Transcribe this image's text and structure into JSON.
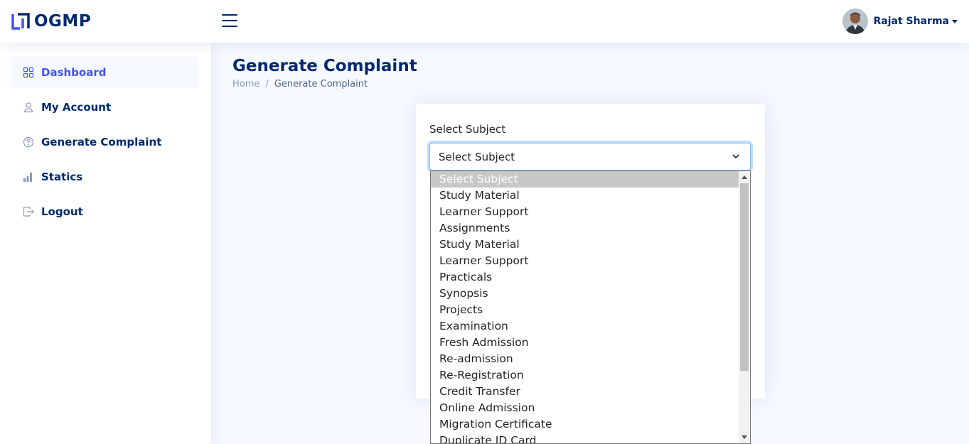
{
  "brand": {
    "name": "OGMP",
    "color": "#012970",
    "accent": "#4154f1"
  },
  "header": {
    "user_name": "Rajat Sharma"
  },
  "sidebar": {
    "items": [
      {
        "label": "Dashboard",
        "icon": "grid-icon",
        "active": true
      },
      {
        "label": "My Account",
        "icon": "person-icon"
      },
      {
        "label": "Generate Complaint",
        "icon": "question-circle-icon"
      },
      {
        "label": "Statics",
        "icon": "bar-chart-icon"
      },
      {
        "label": "Logout",
        "icon": "box-arrow-right-icon"
      }
    ]
  },
  "page": {
    "title": "Generate Complaint",
    "breadcrumb": [
      "Home",
      "Generate Complaint"
    ]
  },
  "form": {
    "subject_label": "Select Subject",
    "subject_value": "Select Subject",
    "options": [
      "Select Subject",
      "Study Material",
      "Learner Support",
      "Assignments",
      "Study Material",
      "Learner Support",
      "Practicals",
      "Synopsis",
      "Projects",
      "Examination",
      "Fresh Admission",
      "Re-admission",
      "Re-Registration",
      "Credit Transfer",
      "Online Admission",
      "Migration Certificate",
      "Duplicate ID Card"
    ]
  }
}
